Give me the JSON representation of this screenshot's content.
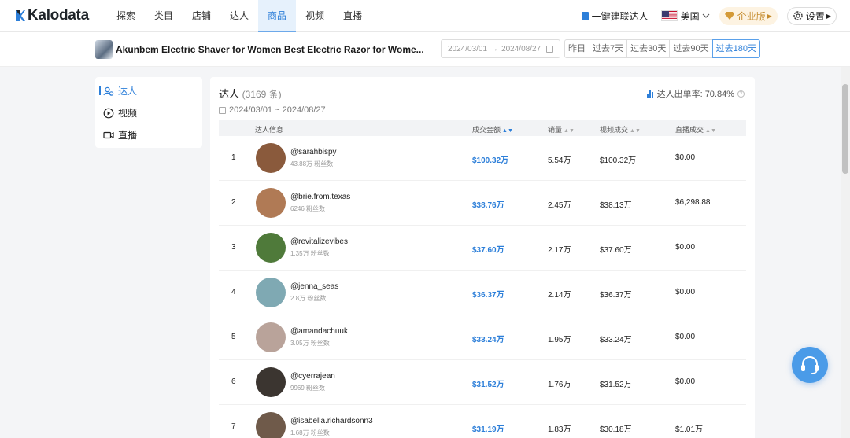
{
  "brand": {
    "name": "Kalodata",
    "accent": "#2d7fd9"
  },
  "nav": {
    "items": [
      {
        "label": "探索"
      },
      {
        "label": "类目"
      },
      {
        "label": "店铺"
      },
      {
        "label": "达人"
      },
      {
        "label": "商品",
        "active": true
      },
      {
        "label": "视频"
      },
      {
        "label": "直播"
      }
    ],
    "bulk_link": "一键建联达人",
    "region": "美国",
    "enterprise": "企业版",
    "settings": "设置"
  },
  "product": {
    "title": "Akunbem Electric Shaver for Women Best Electric Razor for Wome...",
    "date_start": "2024/03/01",
    "date_arrow": "→",
    "date_end": "2024/08/27",
    "ranges": [
      "昨日",
      "过去7天",
      "过去30天",
      "过去90天",
      "过去180天"
    ],
    "active_range": "过去180天"
  },
  "submenu": {
    "items": [
      {
        "label": "达人",
        "icon": "users-icon",
        "active": true
      },
      {
        "label": "视频",
        "icon": "play-circle-icon"
      },
      {
        "label": "直播",
        "icon": "video-camera-icon"
      }
    ]
  },
  "panel": {
    "title": "达人",
    "count": "(3169 条)",
    "rate_label": "达人出单率: 70.84%",
    "date_range": "2024/03/01 ~ 2024/08/27",
    "columns": [
      "达人信息",
      "成交金额",
      "销量",
      "视频成交",
      "直播成交"
    ],
    "rows": [
      {
        "rank": "1",
        "handle": "@sarahbispy",
        "fans": "43.88万 粉丝数",
        "gmv": "$100.32万",
        "sales": "5.54万",
        "video": "$100.32万",
        "live": "$0.00",
        "avatar": "#8a5a3c"
      },
      {
        "rank": "2",
        "handle": "@brie.from.texas",
        "fans": "6246 粉丝数",
        "gmv": "$38.76万",
        "sales": "2.45万",
        "video": "$38.13万",
        "live": "$6,298.88",
        "avatar": "#b07a55"
      },
      {
        "rank": "3",
        "handle": "@revitalizevibes",
        "fans": "1.35万 粉丝数",
        "gmv": "$37.60万",
        "sales": "2.17万",
        "video": "$37.60万",
        "live": "$0.00",
        "avatar": "#4f7a3a"
      },
      {
        "rank": "4",
        "handle": "@jenna_seas",
        "fans": "2.8万 粉丝数",
        "gmv": "$36.37万",
        "sales": "2.14万",
        "video": "$36.37万",
        "live": "$0.00",
        "avatar": "#7fa9b3"
      },
      {
        "rank": "5",
        "handle": "@amandachuuk",
        "fans": "3.05万 粉丝数",
        "gmv": "$33.24万",
        "sales": "1.95万",
        "video": "$33.24万",
        "live": "$0.00",
        "avatar": "#b9a39a"
      },
      {
        "rank": "6",
        "handle": "@cyerrajean",
        "fans": "9969 粉丝数",
        "gmv": "$31.52万",
        "sales": "1.76万",
        "video": "$31.52万",
        "live": "$0.00",
        "avatar": "#3b3530"
      },
      {
        "rank": "7",
        "handle": "@isabella.richardsonn3",
        "fans": "1.68万 粉丝数",
        "gmv": "$31.19万",
        "sales": "1.83万",
        "video": "$30.18万",
        "live": "$1.01万",
        "avatar": "#6f5a4a"
      }
    ]
  }
}
